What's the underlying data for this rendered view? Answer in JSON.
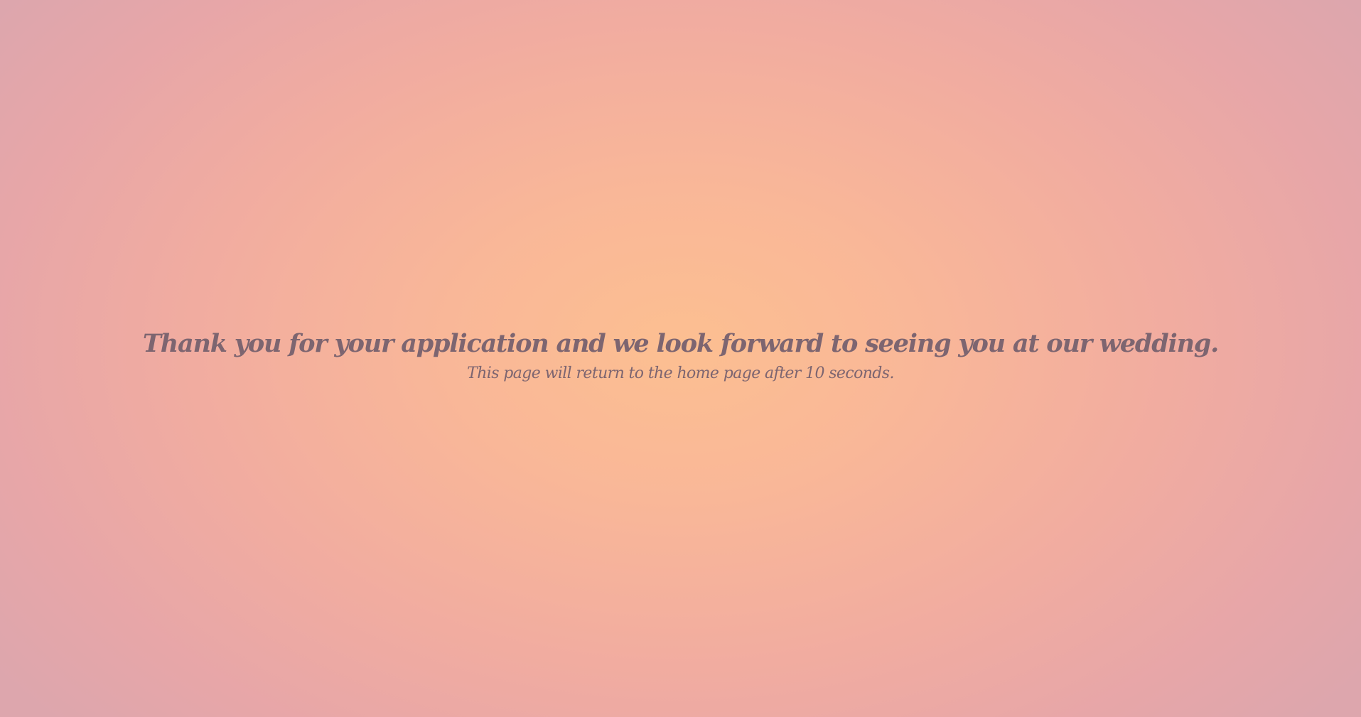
{
  "confirmation": {
    "headline": "Thank you for your application and we look forward to seeing you at our wedding.",
    "redirect_notice": "This page will return to the home page after 10 seconds."
  },
  "colors": {
    "text": "#7d6570",
    "background_center": "#fcbf91",
    "background_edge": "#dda6ad"
  }
}
